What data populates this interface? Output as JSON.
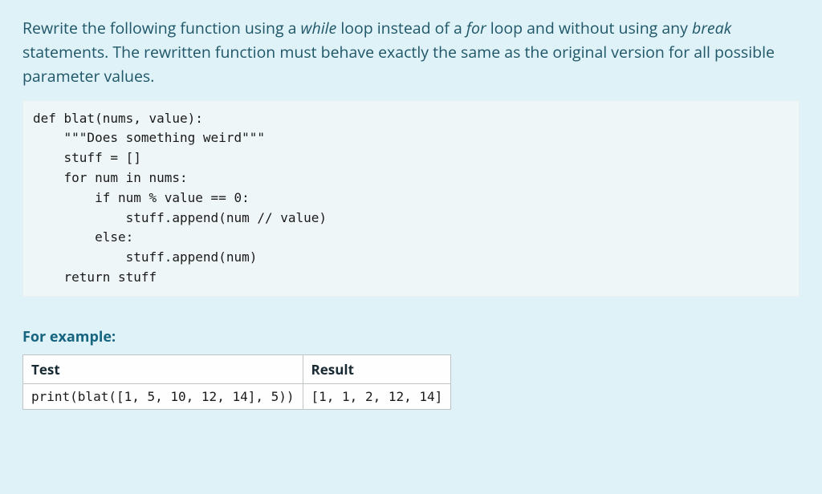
{
  "prompt": {
    "segments": [
      {
        "text": "Rewrite the following function using a ",
        "em": false
      },
      {
        "text": "while",
        "em": true
      },
      {
        "text": " loop instead of a ",
        "em": false
      },
      {
        "text": "for",
        "em": true
      },
      {
        "text": " loop and without using any ",
        "em": false
      },
      {
        "text": "break",
        "em": true
      },
      {
        "text": " statements. The rewritten function must behave exactly the same as the original version for all possible parameter values.",
        "em": false
      }
    ]
  },
  "code": "def blat(nums, value):\n    \"\"\"Does something weird\"\"\"\n    stuff = []\n    for num in nums:\n        if num % value == 0:\n            stuff.append(num // value)\n        else:\n            stuff.append(num)\n    return stuff",
  "example": {
    "heading": "For example:",
    "headers": {
      "test": "Test",
      "result": "Result"
    },
    "rows": [
      {
        "test": "print(blat([1, 5, 10, 12, 14], 5))",
        "result": "[1, 1, 2, 12, 14]"
      }
    ]
  }
}
